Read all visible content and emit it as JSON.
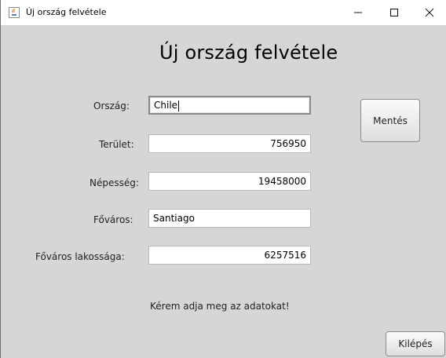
{
  "window": {
    "title": "Új ország felvétele",
    "controls": {
      "minimize": "minimize-icon",
      "maximize": "maximize-icon",
      "close": "close-icon"
    }
  },
  "form": {
    "heading": "Új ország felvétele",
    "fields": {
      "country": {
        "label": "Ország:",
        "value": "Chile"
      },
      "area": {
        "label": "Terület:",
        "value": "756950"
      },
      "population": {
        "label": "Népesség:",
        "value": "19458000"
      },
      "capital": {
        "label": "Főváros:",
        "value": "Santiago"
      },
      "capital_population": {
        "label": "Főváros lakossága:",
        "value": "6257516"
      }
    },
    "buttons": {
      "save": "Mentés",
      "exit": "Kilépés"
    },
    "status": "Kérem adja meg az adatokat!"
  },
  "colors": {
    "background": "#d6d6d6",
    "titlebar": "#ffffff",
    "field_background": "#ffffff",
    "field_border": "#b9b9b9"
  }
}
